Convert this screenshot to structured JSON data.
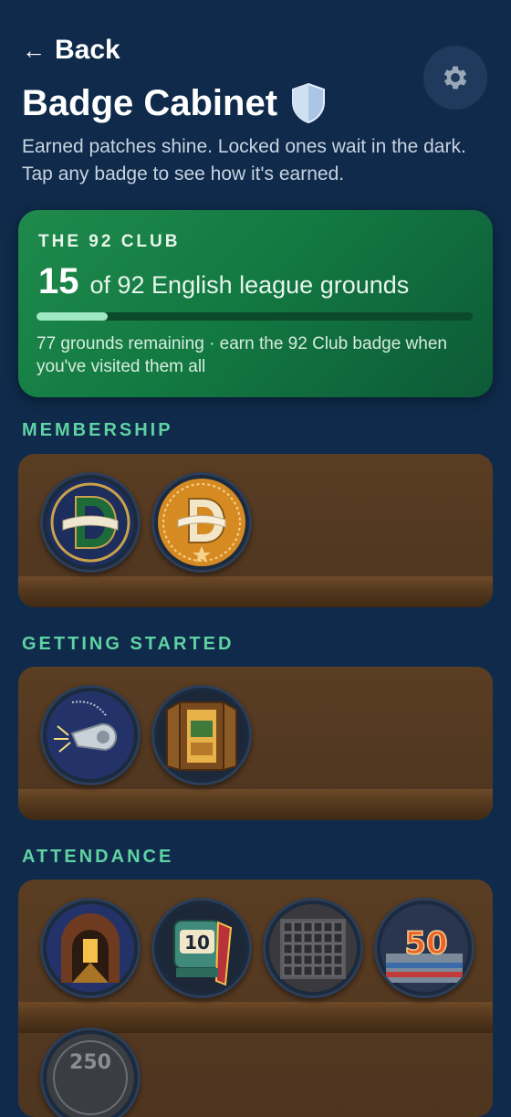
{
  "nav": {
    "back_label": "Back"
  },
  "header": {
    "title": "Badge Cabinet",
    "subtitle": "Earned patches shine. Locked ones wait in the dark. Tap any badge to see how it's earned."
  },
  "club": {
    "label": "THE 92 CLUB",
    "count": "15",
    "count_text": "of 92 English league grounds",
    "progress_fraction": 0.163,
    "note": "77 grounds remaining · earn the 92 Club badge when you've visited them all"
  },
  "sections": {
    "membership": {
      "label": "MEMBERSHIP"
    },
    "getting_started": {
      "label": "GETTING STARTED"
    },
    "attendance": {
      "label": "ATTENDANCE",
      "badge_10": "10",
      "badge_50": "50",
      "badge_250": "250"
    }
  },
  "colors": {
    "background": "#0f2a4a",
    "accent": "#5fd3a3",
    "card_green": "#137a42",
    "shelf": "#4e3520"
  }
}
